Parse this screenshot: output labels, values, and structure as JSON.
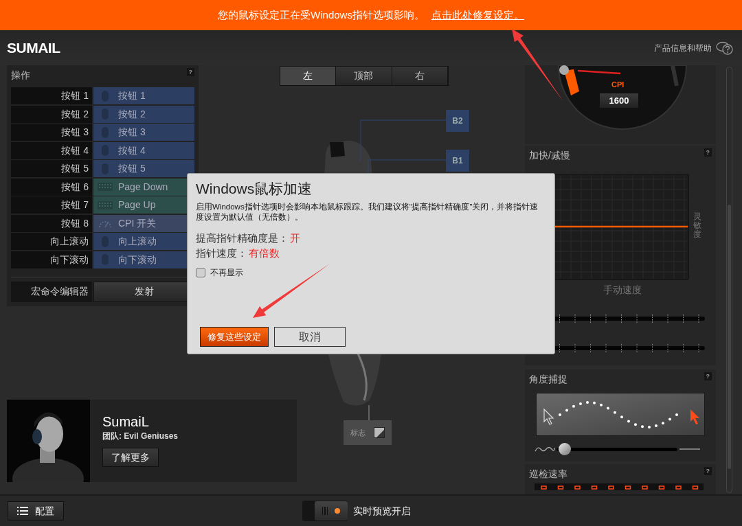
{
  "banner": {
    "message": "您的鼠标设定正在受Windows指针选项影响。",
    "link": "点击此处修复设定。"
  },
  "app_title": "SUMAIL",
  "help_link": "产品信息和帮助",
  "actions_panel": {
    "title": "操作",
    "help": "?",
    "rows": [
      {
        "button": "按钮 1",
        "action": "按钮 1",
        "kind": "mouse"
      },
      {
        "button": "按钮 2",
        "action": "按钮 2",
        "kind": "mouse"
      },
      {
        "button": "按钮 3",
        "action": "按钮 3",
        "kind": "mouse"
      },
      {
        "button": "按钮 4",
        "action": "按钮 4",
        "kind": "mouse"
      },
      {
        "button": "按钮 5",
        "action": "按钮 5",
        "kind": "mouse"
      },
      {
        "button": "按钮 6",
        "action": "Page Down",
        "kind": "keyboard"
      },
      {
        "button": "按钮 7",
        "action": "Page Up",
        "kind": "keyboard"
      },
      {
        "button": "按钮 8",
        "action": "CPI 开关",
        "kind": "cpi"
      },
      {
        "button": "向上滚动",
        "action": "向上滚动",
        "kind": "mouse"
      },
      {
        "button": "向下滚动",
        "action": "向下滚动",
        "kind": "mouse"
      }
    ],
    "macro": {
      "label": "宏命令编辑器",
      "button": "发射"
    }
  },
  "view_tabs": [
    {
      "label": "左",
      "selected": true
    },
    {
      "label": "顶部",
      "selected": false
    },
    {
      "label": "右",
      "selected": false
    }
  ],
  "diagram": {
    "callouts": [
      "B2",
      "B1"
    ],
    "logo_label": "标志"
  },
  "player": {
    "name": "SumaiL",
    "team": "团队: Evil Geniuses",
    "button": "了解更多"
  },
  "cpi": {
    "label": "CPI",
    "value": "1600"
  },
  "accel_panel": {
    "title": "加快/减慢",
    "help": "?",
    "y_label": "灵敏度",
    "x_label": "手动速度"
  },
  "angle_panel": {
    "title": "角度捕捉",
    "help": "?",
    "level": 0.03
  },
  "polling_panel": {
    "title": "巡检速率",
    "help": "?"
  },
  "footer": {
    "config_button": "配置",
    "preview": {
      "label": "实时预览开启",
      "on": true
    }
  },
  "dialog": {
    "title": "Windows鼠标加速",
    "body": "启用Windows指针选项时会影响本地鼠标跟踪。我们建议将“提高指针精确度”关闭，并将指针速度设置为默认值（无倍数）。",
    "settings": [
      {
        "label": "提高指针精确度是：",
        "value": "开"
      },
      {
        "label": "指针速度：",
        "value": "有倍数"
      }
    ],
    "checkbox": {
      "label": "不再显示",
      "checked": false
    },
    "buttons": [
      {
        "label": "修复这些设定",
        "kind": "primary"
      },
      {
        "label": "取消",
        "kind": "secondary"
      }
    ]
  }
}
